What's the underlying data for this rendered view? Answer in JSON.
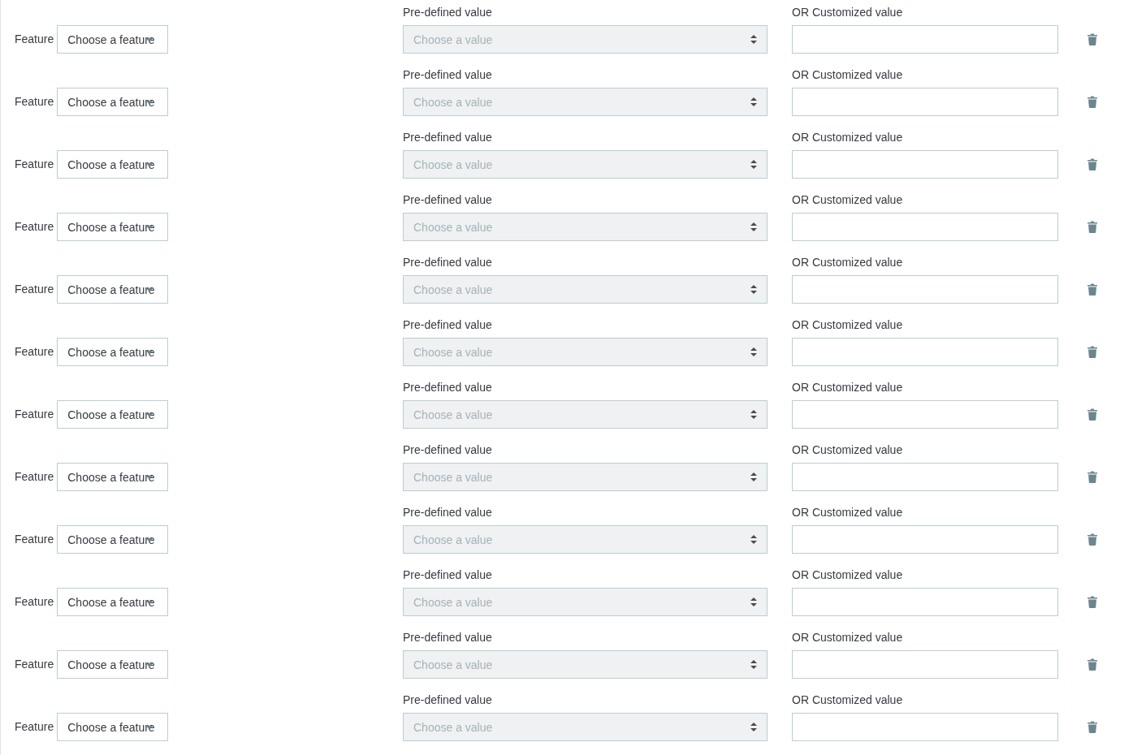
{
  "rows": [
    {
      "feature_label": "Feature",
      "feature_select": {
        "value": "Choose a feature"
      },
      "predefined_label": "Pre-defined value",
      "predefined_select": {
        "placeholder": "Choose a value",
        "disabled": true
      },
      "custom_label": "OR Customized value"
    },
    {
      "feature_label": "Feature",
      "feature_select": {
        "value": "Choose a feature"
      },
      "predefined_label": "Pre-defined value",
      "predefined_select": {
        "placeholder": "Choose a value",
        "disabled": true
      },
      "custom_label": "OR Customized value"
    },
    {
      "feature_label": "Feature",
      "feature_select": {
        "value": "Choose a feature"
      },
      "predefined_label": "Pre-defined value",
      "predefined_select": {
        "placeholder": "Choose a value",
        "disabled": true
      },
      "custom_label": "OR Customized value"
    },
    {
      "feature_label": "Feature",
      "feature_select": {
        "value": "Choose a feature"
      },
      "predefined_label": "Pre-defined value",
      "predefined_select": {
        "placeholder": "Choose a value",
        "disabled": true
      },
      "custom_label": "OR Customized value"
    },
    {
      "feature_label": "Feature",
      "feature_select": {
        "value": "Choose a feature"
      },
      "predefined_label": "Pre-defined value",
      "predefined_select": {
        "placeholder": "Choose a value",
        "disabled": true
      },
      "custom_label": "OR Customized value"
    },
    {
      "feature_label": "Feature",
      "feature_select": {
        "value": "Choose a feature"
      },
      "predefined_label": "Pre-defined value",
      "predefined_select": {
        "placeholder": "Choose a value",
        "disabled": true
      },
      "custom_label": "OR Customized value"
    },
    {
      "feature_label": "Feature",
      "feature_select": {
        "value": "Choose a feature"
      },
      "predefined_label": "Pre-defined value",
      "predefined_select": {
        "placeholder": "Choose a value",
        "disabled": true
      },
      "custom_label": "OR Customized value"
    },
    {
      "feature_label": "Feature",
      "feature_select": {
        "value": "Choose a feature"
      },
      "predefined_label": "Pre-defined value",
      "predefined_select": {
        "placeholder": "Choose a value",
        "disabled": true
      },
      "custom_label": "OR Customized value"
    },
    {
      "feature_label": "Feature",
      "feature_select": {
        "value": "Choose a feature"
      },
      "predefined_label": "Pre-defined value",
      "predefined_select": {
        "placeholder": "Choose a value",
        "disabled": true
      },
      "custom_label": "OR Customized value"
    },
    {
      "feature_label": "Feature",
      "feature_select": {
        "value": "Choose a feature"
      },
      "predefined_label": "Pre-defined value",
      "predefined_select": {
        "placeholder": "Choose a value",
        "disabled": true
      },
      "custom_label": "OR Customized value"
    },
    {
      "feature_label": "Feature",
      "feature_select": {
        "value": "Choose a feature"
      },
      "predefined_label": "Pre-defined value",
      "predefined_select": {
        "placeholder": "Choose a value",
        "disabled": true
      },
      "custom_label": "OR Customized value"
    },
    {
      "feature_label": "Feature",
      "feature_select": {
        "value": "Choose a feature"
      },
      "predefined_label": "Pre-defined value",
      "predefined_select": {
        "placeholder": "Choose a value",
        "disabled": true
      },
      "custom_label": "OR Customized value"
    }
  ]
}
